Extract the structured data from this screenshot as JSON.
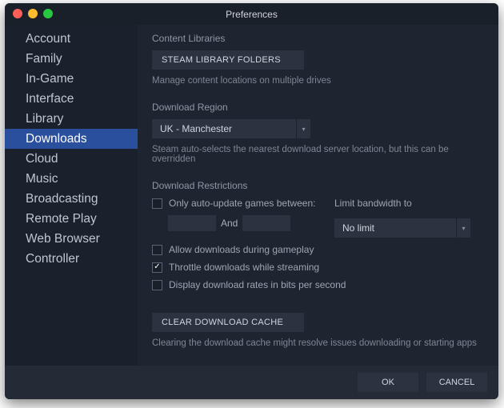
{
  "window": {
    "title": "Preferences"
  },
  "sidebar": {
    "items": [
      {
        "label": "Account"
      },
      {
        "label": "Family"
      },
      {
        "label": "In-Game"
      },
      {
        "label": "Interface"
      },
      {
        "label": "Library"
      },
      {
        "label": "Downloads",
        "active": true
      },
      {
        "label": "Cloud"
      },
      {
        "label": "Music"
      },
      {
        "label": "Broadcasting"
      },
      {
        "label": "Remote Play"
      },
      {
        "label": "Web Browser"
      },
      {
        "label": "Controller"
      }
    ]
  },
  "content_libraries": {
    "heading": "Content Libraries",
    "button": "STEAM LIBRARY FOLDERS",
    "desc": "Manage content locations on multiple drives"
  },
  "download_region": {
    "heading": "Download Region",
    "selected": "UK - Manchester",
    "desc": "Steam auto-selects the nearest download server location, but this can be overridden"
  },
  "restrictions": {
    "heading": "Download Restrictions",
    "auto_update_label": "Only auto-update games between:",
    "and_label": "And",
    "limit_label": "Limit bandwidth to",
    "limit_value": "No limit",
    "allow_gameplay": "Allow downloads during gameplay",
    "throttle_streaming": "Throttle downloads while streaming",
    "display_bits": "Display download rates in bits per second"
  },
  "clear_cache": {
    "button": "CLEAR DOWNLOAD CACHE",
    "desc": "Clearing the download cache might resolve issues downloading or starting apps"
  },
  "footer": {
    "ok": "OK",
    "cancel": "CANCEL"
  }
}
